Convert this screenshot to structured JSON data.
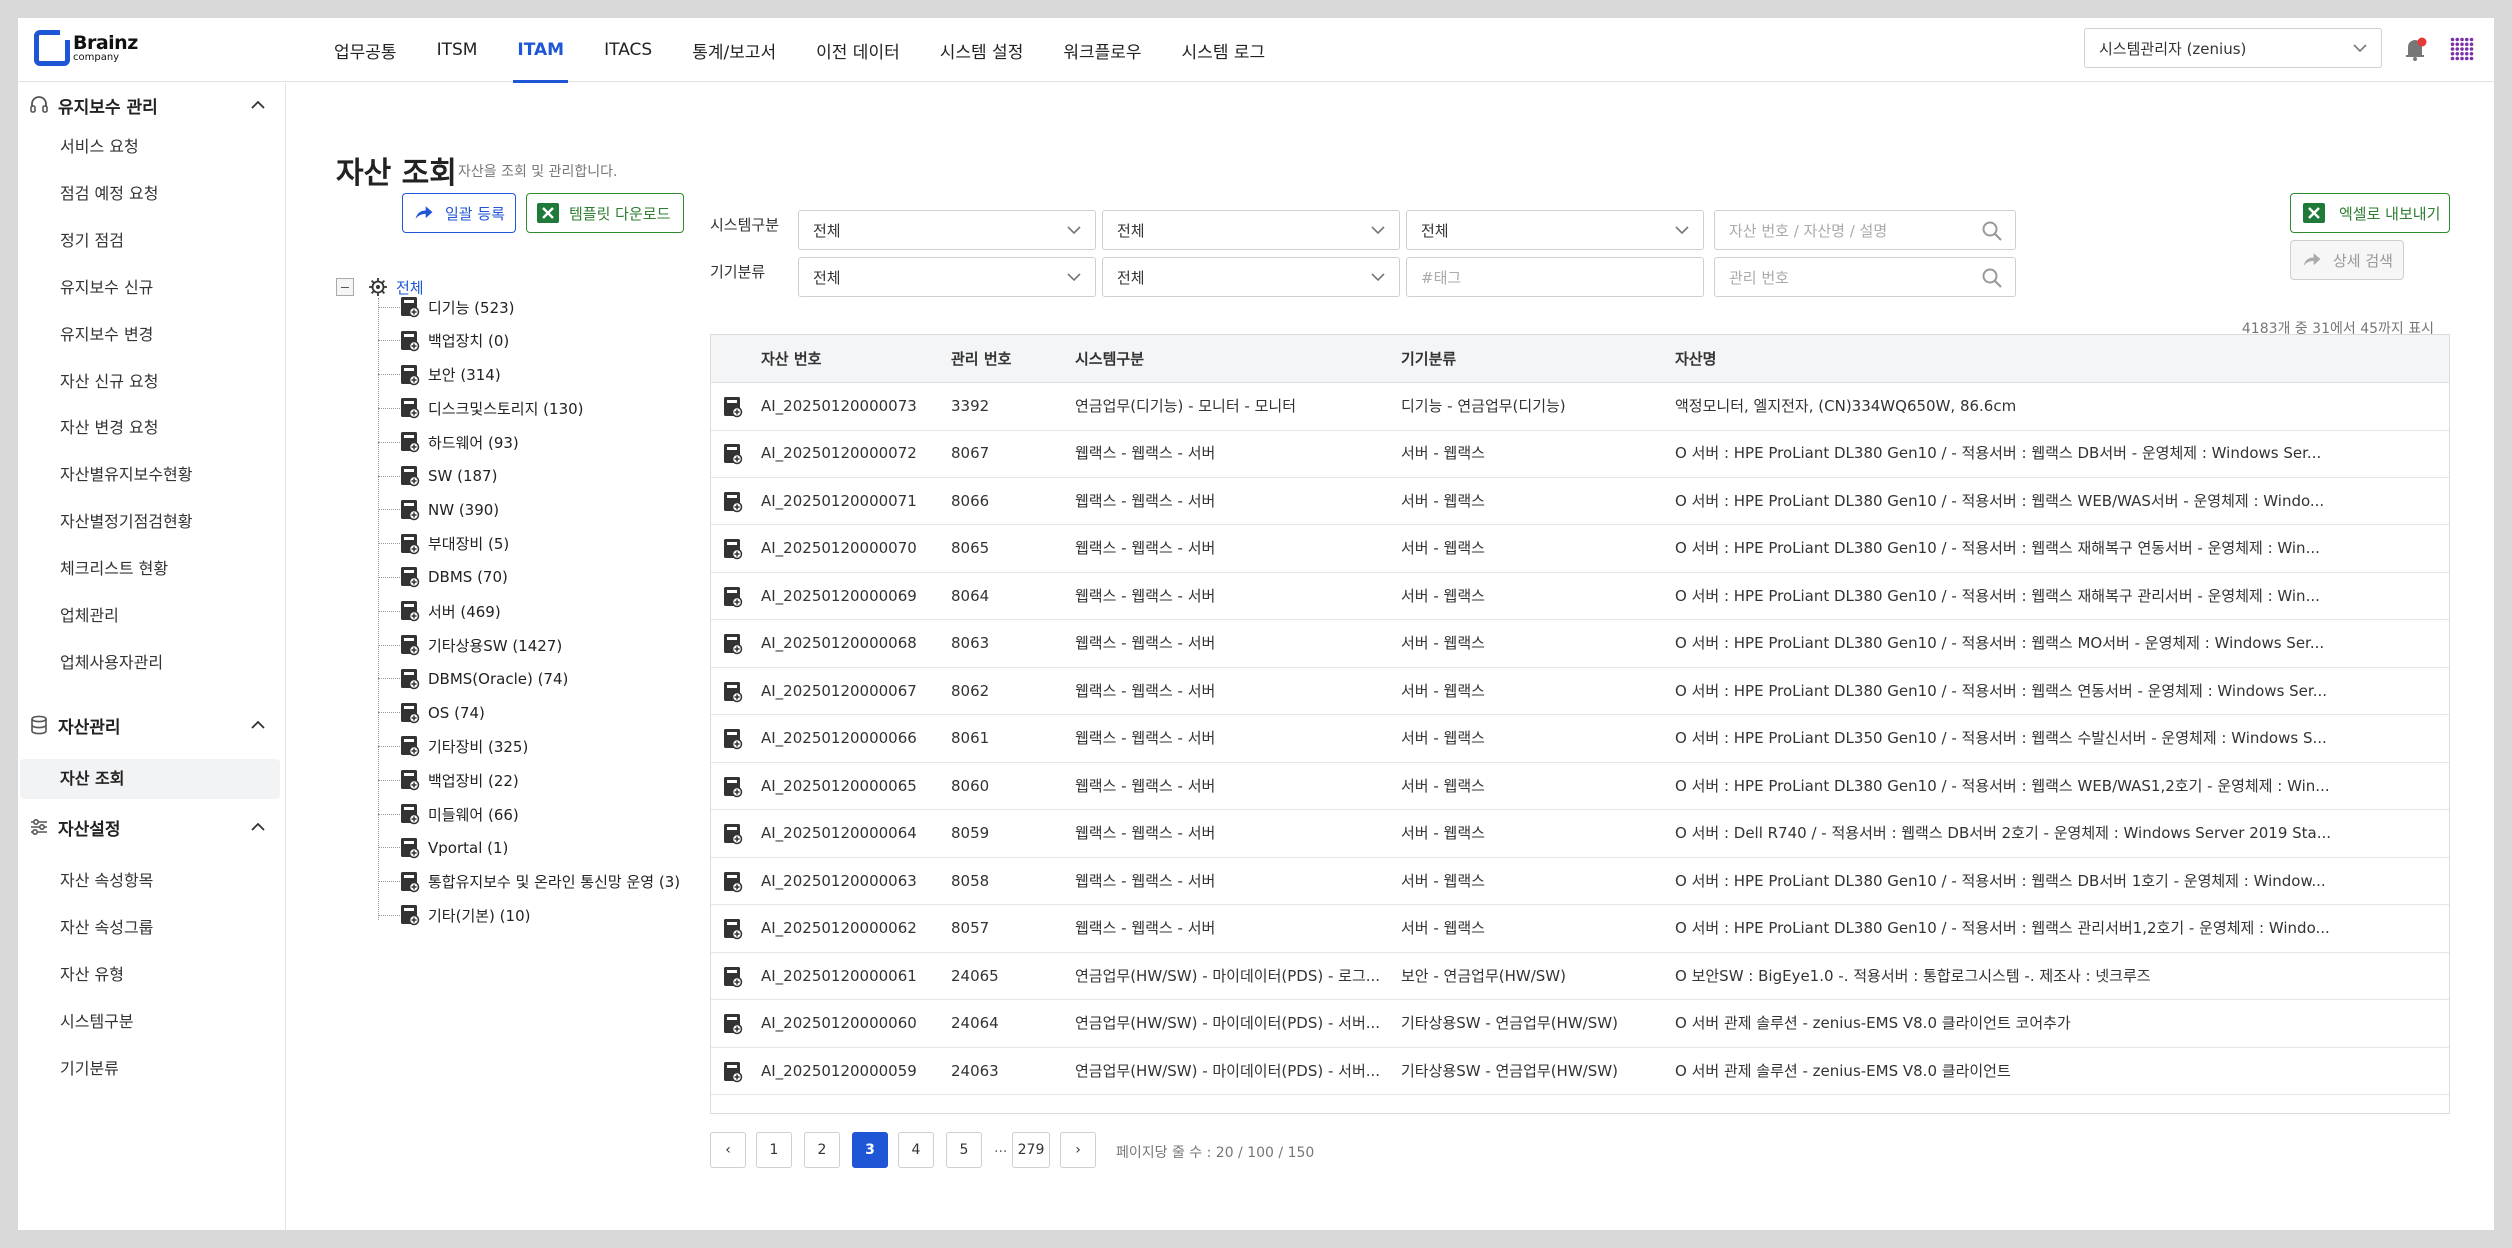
{
  "brand": {
    "name": "Brainz",
    "sub": "company"
  },
  "gnb": [
    "업무공통",
    "ITSM",
    "ITAM",
    "ITACS",
    "통계/보고서",
    "이전 데이터",
    "시스템 설정",
    "워크플로우",
    "시스템 로그"
  ],
  "gnb_active_index": 2,
  "user": {
    "selected": "시스템관리자 (zenius)"
  },
  "sidebar": {
    "group1": {
      "label": "유지보수 관리",
      "items": [
        "서비스 요청",
        "점검 예정 요청",
        "정기 점검",
        "유지보수 신규",
        "유지보수 변경",
        "자산 신규 요청",
        "자산 변경 요청",
        "자산별유지보수현황",
        "자산별정기점검현황",
        "체크리스트 현황",
        "업체관리",
        "업체사용자관리"
      ]
    },
    "group2": {
      "label": "자산관리",
      "items": [
        "자산 조회"
      ]
    },
    "group3": {
      "label": "자산설정",
      "items": [
        "자산 속성항목",
        "자산 속성그룹",
        "자산 유형",
        "시스템구분",
        "기기분류"
      ]
    }
  },
  "page": {
    "title": "자산 조회",
    "subtitle": "자산을 조회 및 관리합니다."
  },
  "buttons": {
    "bulk": "일괄 등록",
    "template": "템플릿 다운로드",
    "excel": "엑셀로 내보내기",
    "detail": "상세 검색"
  },
  "tree": {
    "root": "전체",
    "items": [
      "디기능 (523)",
      "백업장치 (0)",
      "보안 (314)",
      "디스크및스토리지 (130)",
      "하드웨어 (93)",
      "SW (187)",
      "NW (390)",
      "부대장비 (5)",
      "DBMS (70)",
      "서버 (469)",
      "기타상용SW (1427)",
      "DBMS(Oracle) (74)",
      "OS (74)",
      "기타장비 (325)",
      "백업장비 (22)",
      "미들웨어 (66)",
      "Vportal (1)",
      "통합유지보수 및 온라인 통신망 운영 (3)",
      "기타(기본) (10)"
    ]
  },
  "filters": {
    "system_label": "시스템구분",
    "device_label": "기기분류",
    "sel1": "전체",
    "sel2": "전체",
    "sel3": "전체",
    "sel4": "전체",
    "sel5": "전체",
    "search1_placeholder": "자산 번호 / 자산명 / 설명",
    "tag_placeholder": "#태그",
    "mgmt_placeholder": "관리 번호"
  },
  "count_text": "4183개 중 31에서 45까지 표시",
  "table": {
    "headers": [
      "자산 번호",
      "관리 번호",
      "시스템구분",
      "기기분류",
      "자산명"
    ],
    "rows": [
      [
        "AI_20250120000073",
        "3392",
        "연금업무(디기능) - 모니터 - 모니터",
        "디기능 - 연금업무(디기능)",
        "액정모니터, 엘지전자, (CN)334WQ650W, 86.6cm"
      ],
      [
        "AI_20250120000072",
        "8067",
        "웹랙스 - 웹랙스 - 서버",
        "서버 - 웹랙스",
        "O 서버 : HPE ProLiant DL380 Gen10 / - 적용서버 : 웹랙스 DB서버 - 운영체제 : Windows Ser..."
      ],
      [
        "AI_20250120000071",
        "8066",
        "웹랙스 - 웹랙스 - 서버",
        "서버 - 웹랙스",
        "O 서버 : HPE ProLiant DL380 Gen10 / - 적용서버 : 웹랙스 WEB/WAS서버 - 운영체제 : Windo..."
      ],
      [
        "AI_20250120000070",
        "8065",
        "웹랙스 - 웹랙스 - 서버",
        "서버 - 웹랙스",
        "O 서버 : HPE ProLiant DL380 Gen10 / - 적용서버 : 웹랙스 재해복구 연동서버 - 운영체제 : Win..."
      ],
      [
        "AI_20250120000069",
        "8064",
        "웹랙스 - 웹랙스 - 서버",
        "서버 - 웹랙스",
        "O 서버 : HPE ProLiant DL380 Gen10 / - 적용서버 : 웹랙스 재해복구 관리서버 - 운영체제 : Win..."
      ],
      [
        "AI_20250120000068",
        "8063",
        "웹랙스 - 웹랙스 - 서버",
        "서버 - 웹랙스",
        "O 서버 : HPE ProLiant DL380 Gen10 / - 적용서버 : 웹랙스 MO서버 - 운영체제 : Windows Ser..."
      ],
      [
        "AI_20250120000067",
        "8062",
        "웹랙스 - 웹랙스 - 서버",
        "서버 - 웹랙스",
        "O 서버 : HPE ProLiant DL380 Gen10 / - 적용서버 : 웹랙스 연동서버 - 운영체제 : Windows Ser..."
      ],
      [
        "AI_20250120000066",
        "8061",
        "웹랙스 - 웹랙스 - 서버",
        "서버 - 웹랙스",
        "O 서버 : HPE ProLiant DL350 Gen10 / - 적용서버 : 웹랙스 수발신서버 - 운영체제 : Windows S..."
      ],
      [
        "AI_20250120000065",
        "8060",
        "웹랙스 - 웹랙스 - 서버",
        "서버 - 웹랙스",
        "O 서버 : HPE ProLiant DL380 Gen10 / - 적용서버 : 웹랙스 WEB/WAS1,2호기 - 운영체제 : Win..."
      ],
      [
        "AI_20250120000064",
        "8059",
        "웹랙스 - 웹랙스 - 서버",
        "서버 - 웹랙스",
        "O 서버 : Dell R740 / - 적용서버 : 웹랙스 DB서버 2호기 - 운영체제 : Windows Server 2019 Sta..."
      ],
      [
        "AI_20250120000063",
        "8058",
        "웹랙스 - 웹랙스 - 서버",
        "서버 - 웹랙스",
        "O 서버 : HPE ProLiant DL380 Gen10 / - 적용서버 : 웹랙스 DB서버 1호기 - 운영체제 : Window..."
      ],
      [
        "AI_20250120000062",
        "8057",
        "웹랙스 - 웹랙스 - 서버",
        "서버 - 웹랙스",
        "O 서버 : HPE ProLiant DL380 Gen10 / - 적용서버 : 웹랙스 관리서버1,2호기 - 운영체제 : Windo..."
      ],
      [
        "AI_20250120000061",
        "24065",
        "연금업무(HW/SW) - 마이데이터(PDS) - 로그...",
        "보안 - 연금업무(HW/SW)",
        "O 보안SW : BigEye1.0 -. 적용서버 : 통합로그시스템 -. 제조사 : 넷크루즈"
      ],
      [
        "AI_20250120000060",
        "24064",
        "연금업무(HW/SW) - 마이데이터(PDS) - 서버...",
        "기타상용SW - 연금업무(HW/SW)",
        "O 서버 관제 솔루션 - zenius-EMS V8.0 클라이언트 코어추가"
      ],
      [
        "AI_20250120000059",
        "24063",
        "연금업무(HW/SW) - 마이데이터(PDS) - 서버...",
        "기타상용SW - 연금업무(HW/SW)",
        "O 서버 관제 솔루션 - zenius-EMS V8.0 클라이언트"
      ]
    ]
  },
  "pagination": {
    "prev": "‹",
    "next": "›",
    "pages": [
      "1",
      "2",
      "3",
      "4",
      "5"
    ],
    "active": "3",
    "dots": "...",
    "last": "279",
    "page_size": "페이지당 줄 수 : 20 / 100 / 150"
  },
  "colors": {
    "accent": "#1f56d6",
    "excel_green": "#2e7d32",
    "alert_red": "#e53935",
    "grid_purple": "#7b2fa8"
  }
}
